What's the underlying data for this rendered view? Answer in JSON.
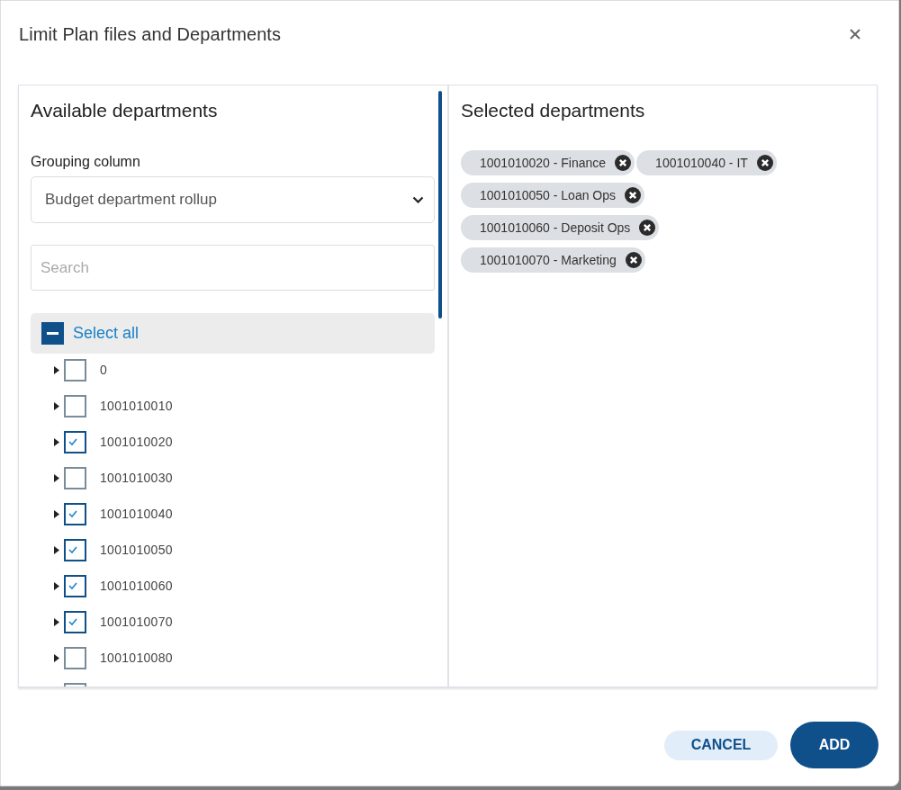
{
  "dialog": {
    "title": "Limit Plan files and Departments"
  },
  "available": {
    "title": "Available departments",
    "grouping_label": "Grouping column",
    "grouping_value": "Budget department rollup",
    "search": {
      "placeholder": "Search"
    },
    "select_all": {
      "label": "Select all",
      "indeterminate": true
    },
    "items": [
      {
        "label": "0",
        "checked": false
      },
      {
        "label": "1001010010",
        "checked": false
      },
      {
        "label": "1001010020",
        "checked": true
      },
      {
        "label": "1001010030",
        "checked": false
      },
      {
        "label": "1001010040",
        "checked": true
      },
      {
        "label": "1001010050",
        "checked": true
      },
      {
        "label": "1001010060",
        "checked": true
      },
      {
        "label": "1001010070",
        "checked": true
      },
      {
        "label": "1001010080",
        "checked": false
      },
      {
        "checked": false
      }
    ]
  },
  "selected": {
    "title": "Selected departments",
    "chips": [
      "1001010020 - Finance",
      "1001010040 - IT",
      "1001010050 - Loan Ops",
      "1001010060 - Deposit Ops",
      "1001010070 - Marketing"
    ]
  },
  "buttons": [
    {
      "label": "CANCEL",
      "kind": "secondary"
    },
    {
      "label": "ADD",
      "kind": "primary"
    }
  ]
}
